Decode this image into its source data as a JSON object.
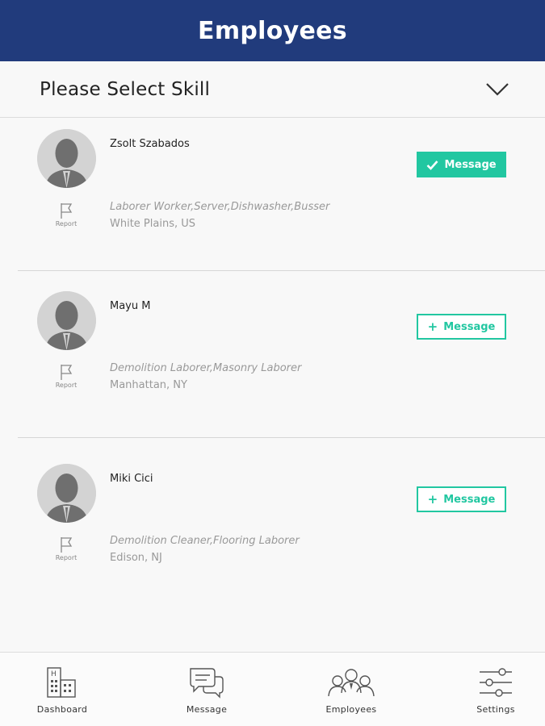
{
  "header": {
    "title": "Employees"
  },
  "skill_select": {
    "label": "Please Select Skill",
    "icon": "chevron-down-icon"
  },
  "employees": [
    {
      "name": "Zsolt Szabados",
      "skills": "Laborer Worker,Server,Dishwasher,Busser",
      "location": "White Plains, US",
      "report_label": "Report",
      "message_label": "Message",
      "message_state": "sent",
      "button_icon": "check-icon"
    },
    {
      "name": "Mayu M",
      "skills": "Demolition Laborer,Masonry Laborer",
      "location": "Manhattan, NY",
      "report_label": "Report",
      "message_label": "Message",
      "message_state": "add",
      "button_icon": "plus-icon"
    },
    {
      "name": "Miki Cici",
      "skills": "Demolition Cleaner,Flooring Laborer",
      "location": "Edison, NJ",
      "report_label": "Report",
      "message_label": "Message",
      "message_state": "add",
      "button_icon": "plus-icon"
    }
  ],
  "tabs": [
    {
      "label": "Dashboard",
      "icon": "building-icon"
    },
    {
      "label": "Message",
      "icon": "chat-bubbles-icon"
    },
    {
      "label": "Employees",
      "icon": "people-group-icon"
    },
    {
      "label": "Settings",
      "icon": "sliders-icon"
    }
  ],
  "colors": {
    "header": "#213b7c",
    "accent": "#22c7a1",
    "muted_text": "#999999"
  }
}
